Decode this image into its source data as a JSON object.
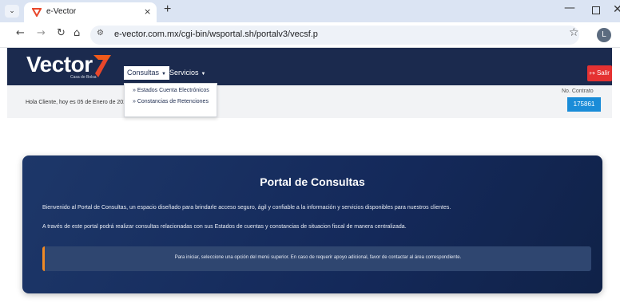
{
  "browser": {
    "tab_title": "e-Vector",
    "tab_close": "×",
    "new_tab": "+",
    "url": "e-vector.com.mx/cgi-bin/wsportal.sh/portalv3/vecsf.p",
    "profile_initial": "L",
    "window_controls": {
      "minimize": "—",
      "close": "✕"
    },
    "nav": {
      "back": "←",
      "forward": "→",
      "reload": "↻",
      "home": "⌂",
      "bookmark": "☆",
      "site_info": "⚙",
      "tab_menu": "⌄"
    }
  },
  "site": {
    "logo_text": "Vector",
    "logo_subtext": "Casa de Bolsa",
    "brand_color": "#1b2a4e",
    "accent_color": "#f05a1a",
    "menu": {
      "consultas": "Consultas",
      "servicios": "Servicios",
      "caret": "▼"
    },
    "dropdown_items": [
      "» Estados Cuenta Electrónicos",
      "» Constancias de Retenciones"
    ],
    "logout_label": "Salir",
    "logout_icon": "↦",
    "greeting": "Hola Cliente, hoy es 05 de Enero de 202",
    "contract_label": "No. Contrato",
    "contract_number": "175861"
  },
  "portal": {
    "title": "Portal de Consultas",
    "paragraph_1": "Bienvenido al Portal de Consultas, un espacio diseñado para brindarle acceso seguro, ágil y confiable a la información y servicios disponibles para nuestros clientes.",
    "paragraph_2": "A través de este portal podrá realizar consultas relacionadas con sus Estados de cuentas y constancias de situacion fiscal de manera centralizada.",
    "notice": "Para iniciar, seleccione una opción del menú superior. En caso de requerir apoyo adicional, favor de contactar al área correspondiente."
  }
}
